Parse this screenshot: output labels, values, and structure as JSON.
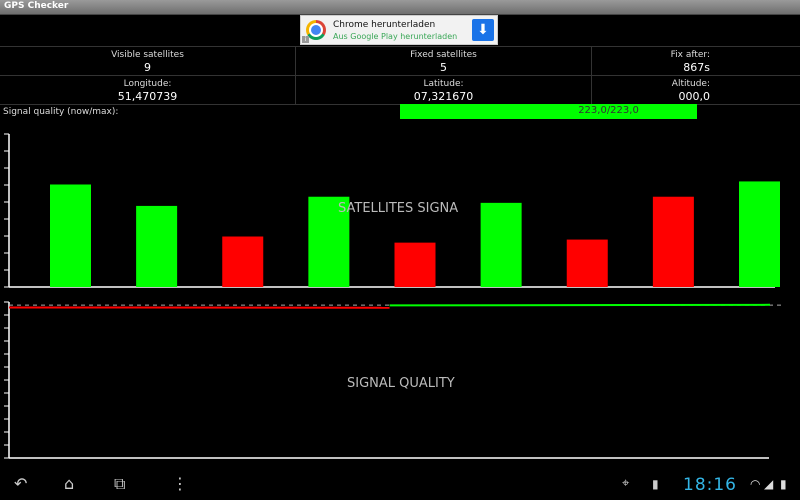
{
  "app": {
    "title": "GPS Checker"
  },
  "ad": {
    "title": "Chrome herunterladen",
    "subtitle": "Aus Google Play herunterladen",
    "corner_icon": "ad-choices-icon",
    "logo_icon": "chrome-logo-icon",
    "button_icon": "download-arrow-icon"
  },
  "stats": {
    "visible_label": "Visible satellites",
    "visible_value": "9",
    "fixed_label": "Fixed satellites",
    "fixed_value": "5",
    "fix_label": "Fix after:",
    "fix_value": "867s",
    "longitude_label": "Longitude:",
    "longitude_value": "51,470739",
    "latitude_label": "Latitude:",
    "latitude_value": "07,321670",
    "altitude_label": "Altitude:",
    "altitude_value": "000,0"
  },
  "signal_quality": {
    "label": "Signal quality (now/max):",
    "text": "223,0/223,0",
    "fraction": 1.0,
    "bar_color": "#00ff00"
  },
  "colors": {
    "good": "#00ff00",
    "bad": "#ff0000",
    "axis": "#ffffff",
    "clock": "#33b5e5"
  },
  "chart_data": [
    {
      "type": "bar",
      "title": "SATELLITES SIGNA",
      "categories": [
        "",
        "",
        "",
        "",
        "",
        "",
        "",
        "",
        ""
      ],
      "values": [
        67,
        53,
        33,
        59,
        29,
        55,
        31,
        59,
        69
      ],
      "colors": [
        "#00ff00",
        "#00ff00",
        "#ff0000",
        "#00ff00",
        "#ff0000",
        "#00ff00",
        "#ff0000",
        "#ff0000",
        "#00ff00"
      ],
      "ylim": [
        0,
        100
      ],
      "grid": false
    },
    {
      "type": "line",
      "title": "SIGNAL QUALITY",
      "series": [
        {
          "color": "#ff0000",
          "x": [
            0,
            0.5
          ],
          "y": [
            96.5,
            96.3
          ]
        },
        {
          "color": "#00ff00",
          "x": [
            0.5,
            1.0
          ],
          "y": [
            97.8,
            98.2
          ]
        }
      ],
      "reference_line": 98,
      "ylim": [
        0,
        100
      ],
      "grid": false
    }
  ],
  "navbar": {
    "back_icon": "back-icon",
    "home_icon": "home-icon",
    "recents_icon": "recent-apps-icon",
    "menu_icon": "overflow-menu-icon",
    "gps_icon": "gps-status-icon",
    "sd_icon": "sd-card-icon",
    "wifi_icon": "wifi-icon",
    "signal_icon": "cell-signal-icon",
    "battery_icon": "battery-icon"
  },
  "clock": {
    "time": "18:16"
  }
}
